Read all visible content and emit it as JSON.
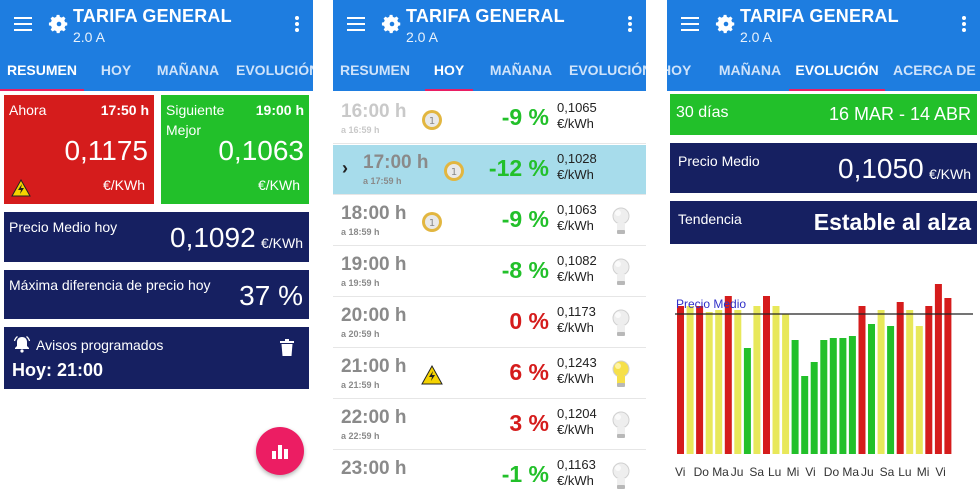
{
  "colors": {
    "appbar": "#1e7de0",
    "tab_indicator": "#e91e63",
    "red": "#d51c1c",
    "green": "#22c02a",
    "navy": "#162061",
    "highlight": "#a7dceb",
    "yellow": "#e8e85a",
    "fab": "#ec1d63"
  },
  "app": {
    "title": "TARIFA GENERAL",
    "subtitle": "2.0 A"
  },
  "panel1": {
    "tabs": [
      "RESUMEN",
      "HOY",
      "MAÑANA",
      "EVOLUCIÓN"
    ],
    "active_tab": "RESUMEN",
    "now": {
      "label": "Ahora",
      "time": "17:50 h",
      "price": "0,1175",
      "unit": "€/KWh",
      "icon": "warning-icon"
    },
    "next_best": {
      "label_line1": "Siguiente",
      "label_line2": "Mejor",
      "time": "19:00 h",
      "price": "0,1063",
      "unit": "€/KWh"
    },
    "avg_today": {
      "label": "Precio Medio hoy",
      "price": "0,1092",
      "unit": "€/KWh"
    },
    "max_diff": {
      "label": "Máxima diferencia de precio hoy",
      "value": "37 %"
    },
    "alerts": {
      "title": "Avisos programados",
      "value": "Hoy: 21:00",
      "icon": "bell-icon",
      "delete_icon": "trash-icon"
    },
    "fab_icon": "bar-chart-icon"
  },
  "panel2": {
    "tabs": [
      "RESUMEN",
      "HOY",
      "MAÑANA",
      "EVOLUCIÓN"
    ],
    "active_tab": "HOY",
    "rows": [
      {
        "hour": "16:00 h",
        "sub": "a 16:59 h",
        "pct": "-9 %",
        "price": "0,1065",
        "unit": "€/kWh",
        "icon": "coin-icon",
        "bulb": "none",
        "faded": true
      },
      {
        "hour": "17:00 h",
        "sub": "a 17:59 h",
        "pct": "-12 %",
        "price": "0,1028",
        "unit": "€/kWh",
        "icon": "coin-icon",
        "bulb": "none",
        "selected": true
      },
      {
        "hour": "18:00 h",
        "sub": "a 18:59 h",
        "pct": "-9 %",
        "price": "0,1063",
        "unit": "€/kWh",
        "icon": "coin-icon",
        "bulb": "off"
      },
      {
        "hour": "19:00 h",
        "sub": "a 19:59 h",
        "pct": "-8 %",
        "price": "0,1082",
        "unit": "€/kWh",
        "icon": "",
        "bulb": "off"
      },
      {
        "hour": "20:00 h",
        "sub": "a 20:59 h",
        "pct": "0 %",
        "price": "0,1173",
        "unit": "€/kWh",
        "icon": "",
        "bulb": "off"
      },
      {
        "hour": "21:00 h",
        "sub": "a 21:59 h",
        "pct": "6 %",
        "price": "0,1243",
        "unit": "€/kWh",
        "icon": "warning-icon",
        "bulb": "on"
      },
      {
        "hour": "22:00 h",
        "sub": "a 22:59 h",
        "pct": "3 %",
        "price": "0,1204",
        "unit": "€/kWh",
        "icon": "",
        "bulb": "off"
      },
      {
        "hour": "23:00 h",
        "sub": "",
        "pct": "-1 %",
        "price": "0,1163",
        "unit": "€/kWh",
        "icon": "",
        "bulb": "off"
      }
    ]
  },
  "panel3": {
    "tabs": [
      "HOY",
      "MAÑANA",
      "EVOLUCIÓN",
      "ACERCA DE"
    ],
    "active_tab": "EVOLUCIÓN",
    "range": {
      "label": "30 días",
      "dates": "16 MAR - 14 ABR"
    },
    "avg": {
      "label": "Precio Medio",
      "price": "0,1050",
      "unit": "€/KWh"
    },
    "trend": {
      "label": "Tendencia",
      "value": "Estable al alza"
    }
  },
  "chart_data": {
    "type": "bar",
    "reference_line": {
      "label": "Precio Medio"
    },
    "day_labels": [
      "Vi",
      "Do",
      "Ma",
      "Ju",
      "Sa",
      "Lu",
      "Mi",
      "Vi",
      "Do",
      "Ma",
      "Ju",
      "Sa",
      "Lu",
      "Mi",
      "Vi"
    ],
    "bars": [
      {
        "level": 0.74,
        "color": "red"
      },
      {
        "level": 0.74,
        "color": "yellow"
      },
      {
        "level": 0.74,
        "color": "red"
      },
      {
        "level": 0.71,
        "color": "yellow"
      },
      {
        "level": 0.72,
        "color": "yellow"
      },
      {
        "level": 0.79,
        "color": "red"
      },
      {
        "level": 0.72,
        "color": "yellow"
      },
      {
        "level": 0.53,
        "color": "green"
      },
      {
        "level": 0.74,
        "color": "yellow"
      },
      {
        "level": 0.79,
        "color": "red"
      },
      {
        "level": 0.74,
        "color": "yellow"
      },
      {
        "level": 0.7,
        "color": "yellow"
      },
      {
        "level": 0.57,
        "color": "green"
      },
      {
        "level": 0.39,
        "color": "green"
      },
      {
        "level": 0.46,
        "color": "green"
      },
      {
        "level": 0.57,
        "color": "green"
      },
      {
        "level": 0.58,
        "color": "green"
      },
      {
        "level": 0.58,
        "color": "green"
      },
      {
        "level": 0.59,
        "color": "green"
      },
      {
        "level": 0.74,
        "color": "red"
      },
      {
        "level": 0.65,
        "color": "green"
      },
      {
        "level": 0.72,
        "color": "yellow"
      },
      {
        "level": 0.64,
        "color": "green"
      },
      {
        "level": 0.76,
        "color": "red"
      },
      {
        "level": 0.72,
        "color": "yellow"
      },
      {
        "level": 0.64,
        "color": "yellow"
      },
      {
        "level": 0.74,
        "color": "red"
      },
      {
        "level": 0.85,
        "color": "red"
      },
      {
        "level": 0.78,
        "color": "red"
      }
    ],
    "reference_level": 0.7
  }
}
